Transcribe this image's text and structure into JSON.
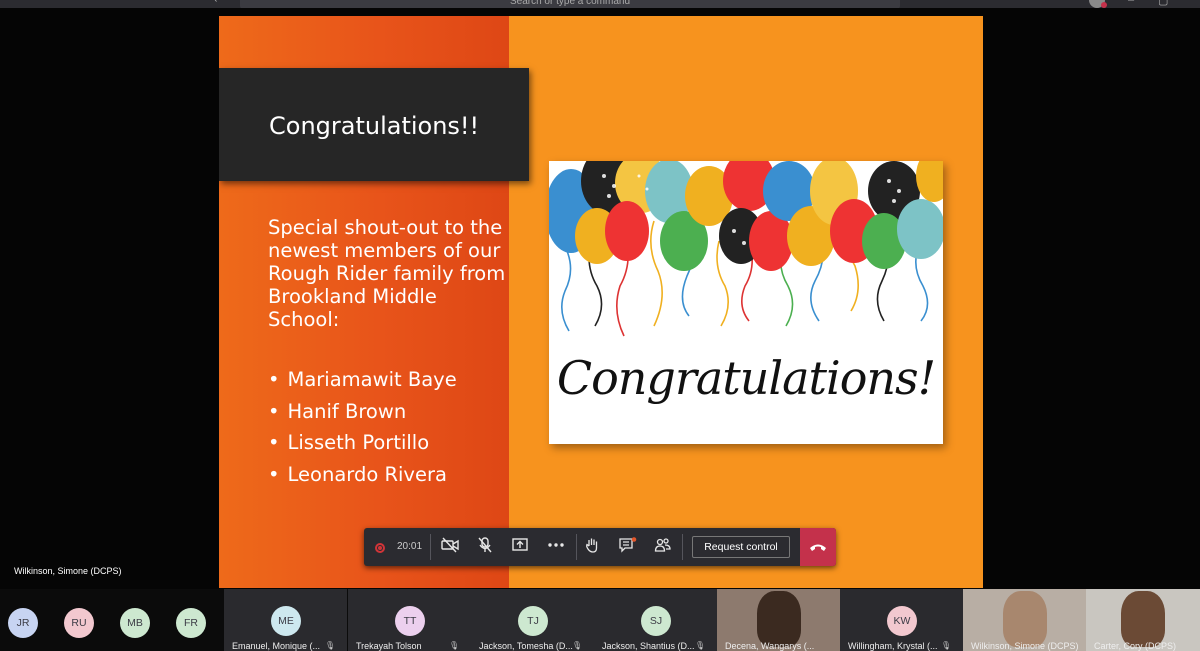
{
  "titlebar": {
    "back_glyph": "‹",
    "search_placeholder": "Search or type a command",
    "minimize_glyph": "–",
    "maximize_glyph": "▢"
  },
  "slide": {
    "title": "Congratulations!!",
    "body": "Special shout-out to the newest members of our Rough Rider family from Brookland Middle School:",
    "names": [
      "Mariamawit Baye",
      "Hanif Brown",
      "Lisseth Portillo",
      "Leonardo Rivera"
    ],
    "card_text": "Congratulations!"
  },
  "presenter": {
    "name": "Wilkinson, Simone (DCPS)"
  },
  "controls": {
    "timer": "20:01",
    "request_control": "Request control",
    "icons": [
      "camera-off-icon",
      "mic-off-icon",
      "share-screen-icon",
      "more-icon",
      "raise-hand-icon",
      "chat-icon",
      "participants-icon",
      "hang-up-icon"
    ],
    "recording_color": "#d13438",
    "hangup_color": "#c4314b"
  },
  "participants_small": [
    {
      "initials": "JR",
      "color": "#c7d4f2"
    },
    {
      "initials": "RU",
      "color": "#f2c8cf"
    },
    {
      "initials": "MB",
      "color": "#cde8d0"
    },
    {
      "initials": "FR",
      "color": "#cde8d0"
    }
  ],
  "participants_tiles": [
    {
      "initials": "ME",
      "name": "Emanuel, Monique (...",
      "color": "#cde8ef"
    },
    {
      "initials": "TT",
      "name": "Trekayah Tolson",
      "color": "#ecd0ee"
    },
    {
      "initials": "TJ",
      "name": "Jackson, Tomesha (D...",
      "color": "#cde8d0"
    },
    {
      "initials": "SJ",
      "name": "Jackson, Shantius (D...",
      "color": "#cde8d0"
    },
    {
      "initials": "",
      "name": "Decena, Wangarys (...",
      "color": "#6b5a4a"
    },
    {
      "initials": "KW",
      "name": "Willingham, Krystal (...",
      "color": "#f2c8cf"
    },
    {
      "initials": "",
      "name": "Wilkinson, Simone (DCPS)",
      "color": "#8a7a6a"
    },
    {
      "initials": "",
      "name": "Carter, Cory (DCPS)",
      "color": "#5a4030"
    }
  ]
}
